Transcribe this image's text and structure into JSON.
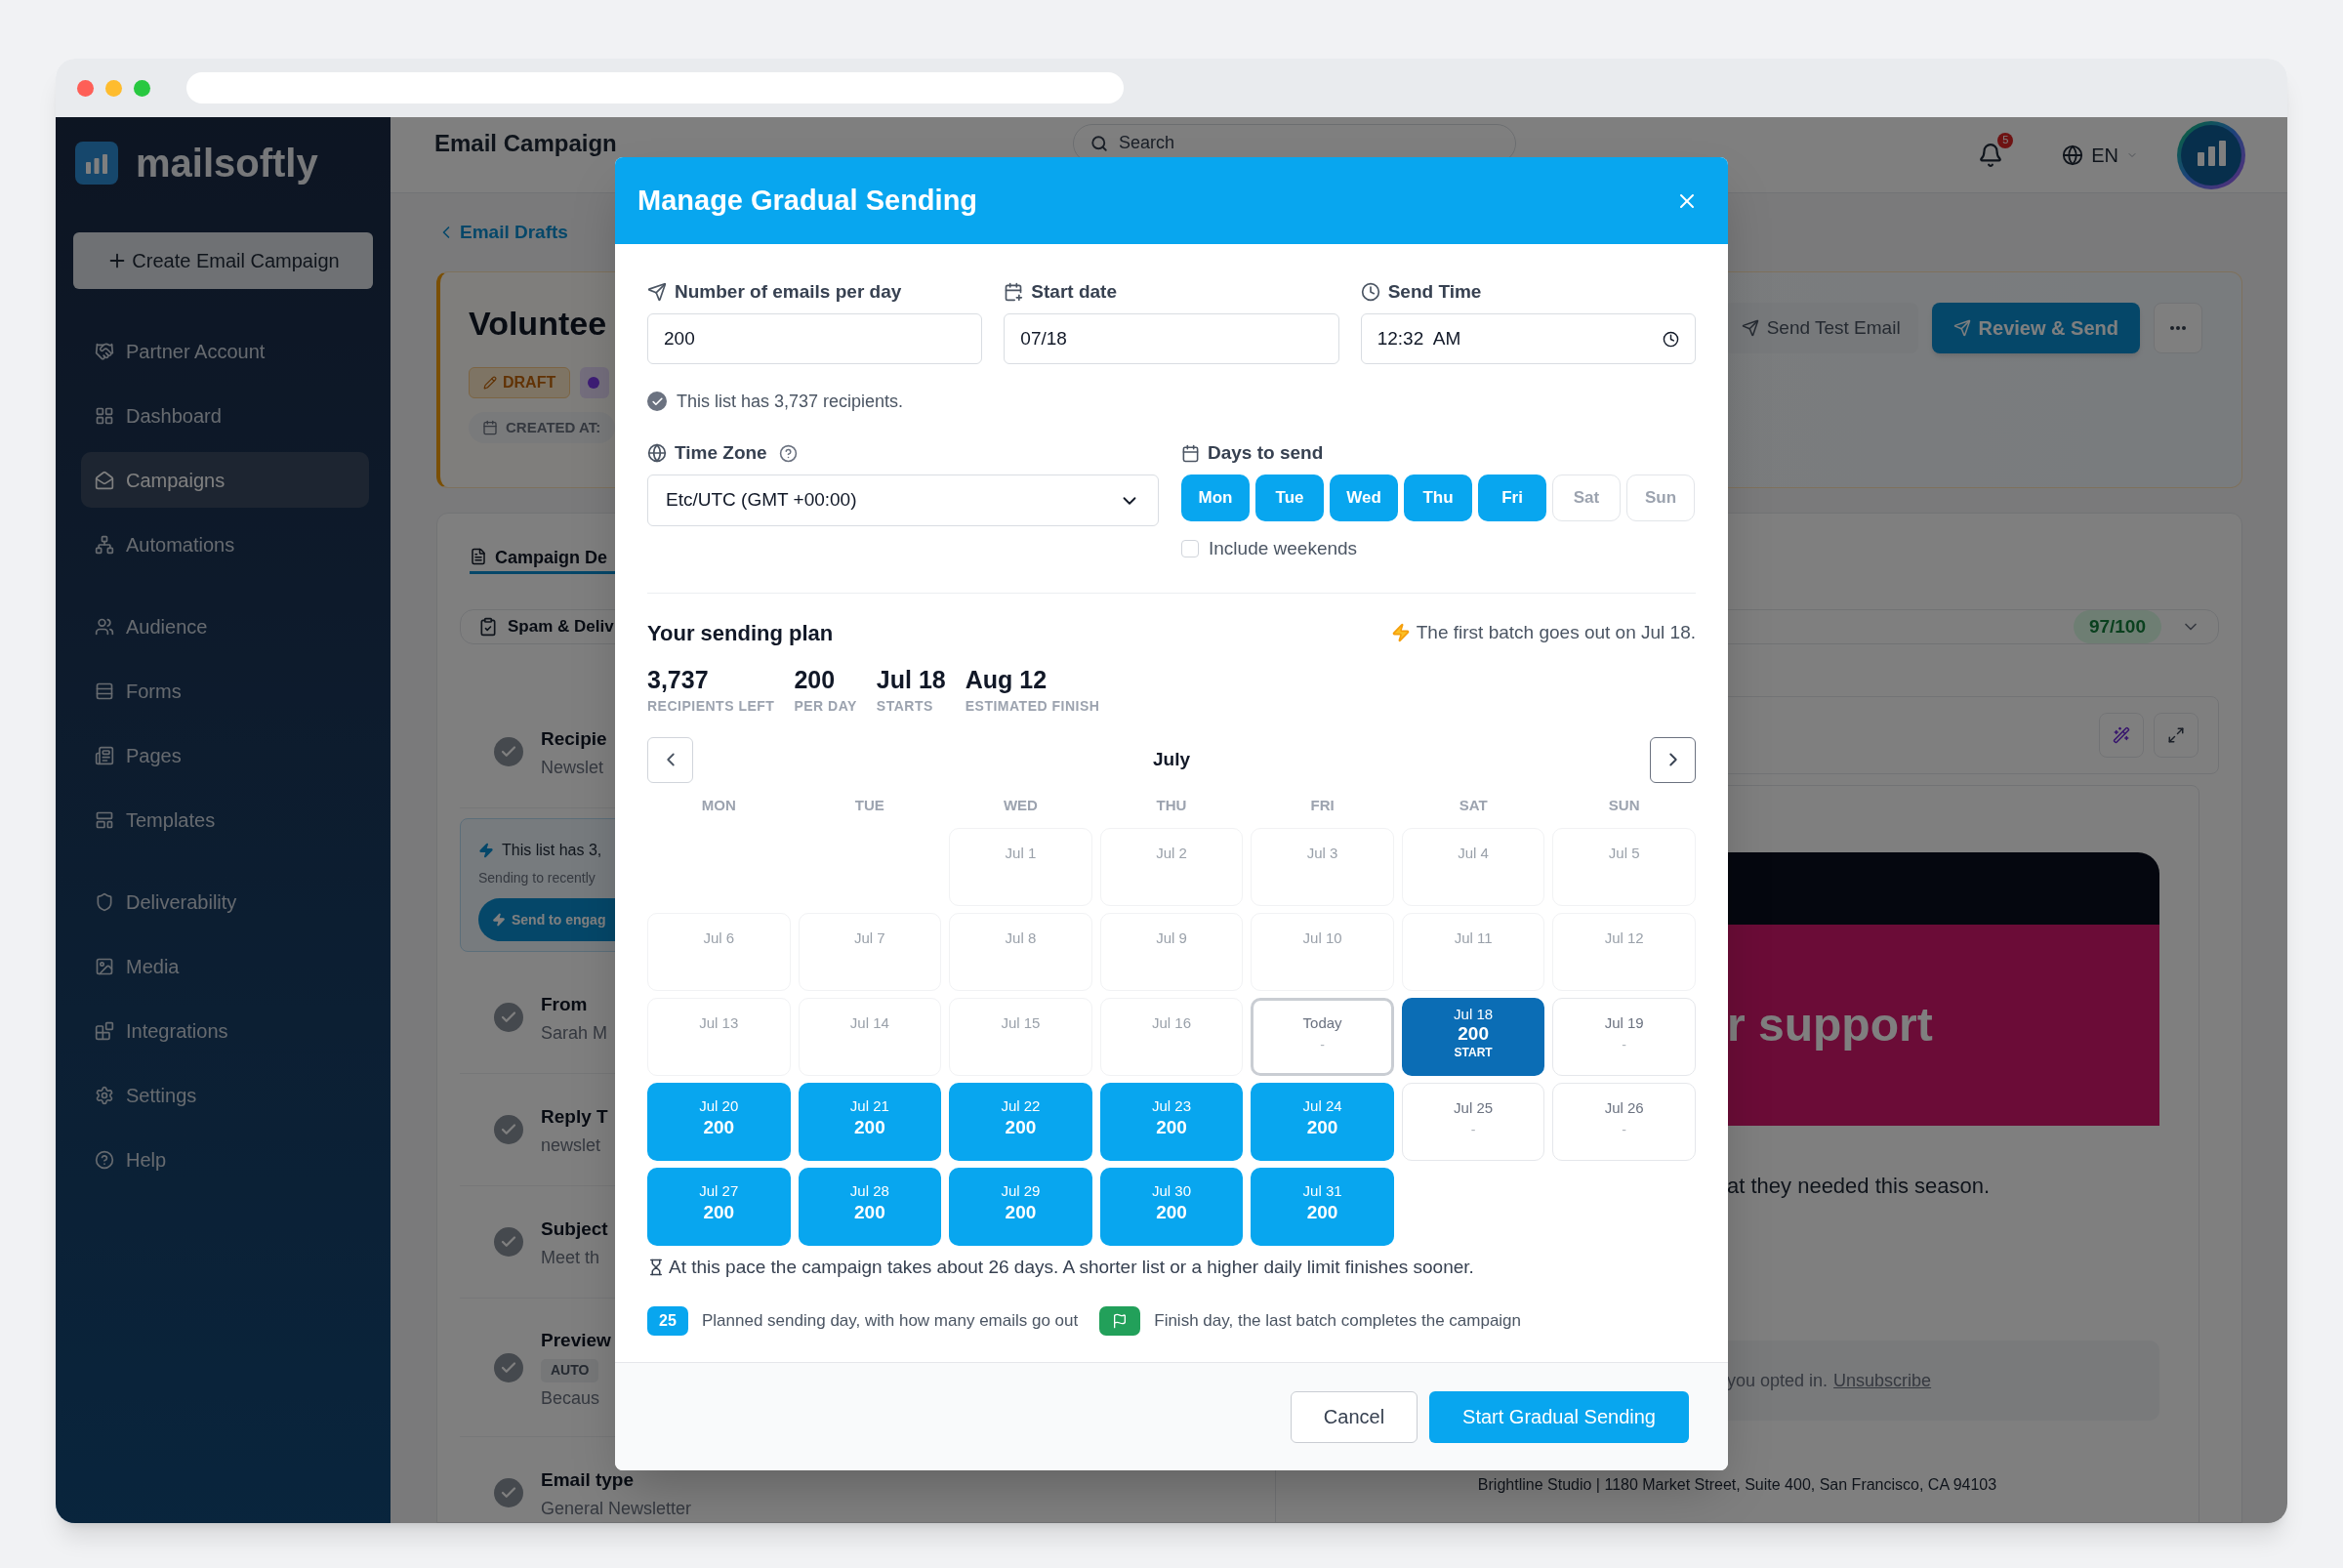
{
  "sidebar": {
    "logo": "mailsoftly",
    "create_button": "Create Email Campaign",
    "groups": [
      [
        {
          "label": "Partner Account",
          "selected": false
        },
        {
          "label": "Dashboard",
          "selected": false
        },
        {
          "label": "Campaigns",
          "selected": true
        },
        {
          "label": "Automations",
          "selected": false
        }
      ],
      [
        {
          "label": "Audience",
          "selected": false
        },
        {
          "label": "Forms",
          "selected": false
        },
        {
          "label": "Pages",
          "selected": false
        },
        {
          "label": "Templates",
          "selected": false
        }
      ],
      [
        {
          "label": "Deliverability",
          "selected": false
        },
        {
          "label": "Media",
          "selected": false
        },
        {
          "label": "Integrations",
          "selected": false
        },
        {
          "label": "Settings",
          "selected": false
        },
        {
          "label": "Help",
          "selected": false
        }
      ]
    ]
  },
  "header": {
    "title": "Email Campaign",
    "search": {
      "placeholder": "Search"
    },
    "notifications": "5",
    "language": "EN"
  },
  "campaign": {
    "back_link": "Email Drafts",
    "title": "Voluntee",
    "status": "DRAFT",
    "created_label": "CREATED AT:",
    "test_button": "Send Test Email",
    "review_button": "Review & Send"
  },
  "details": {
    "tab": "Campaign De",
    "spam": {
      "label": "Spam & Deliv",
      "score": "97/100"
    },
    "checklist": [
      {
        "kind": "field",
        "title": "Recipie",
        "value": "Newslet"
      },
      {
        "kind": "notice",
        "title": "This list has 3,",
        "value": "Sending to recently",
        "button": "Send to engag"
      },
      {
        "kind": "field",
        "title": "From",
        "value": "Sarah M"
      },
      {
        "kind": "field",
        "title": "Reply T",
        "value": "newslet"
      },
      {
        "kind": "field",
        "title": "Subject",
        "value": "Meet th"
      },
      {
        "kind": "field",
        "title": "Preview",
        "badge": "AUTO",
        "value": "Becaus"
      },
      {
        "kind": "field",
        "title": "Email type",
        "value": "General Newsletter"
      }
    ]
  },
  "preview": {
    "headline": "r support",
    "body": "at they needed this season.",
    "footer_text": "you opted in.",
    "unsubscribe": "Unsubscribe",
    "address": "Brightline Studio | 1180 Market Street, Suite 400, San Francisco, CA 94103"
  },
  "modal": {
    "title": "Manage Gradual Sending",
    "fields": [
      {
        "label": "Number of emails per day",
        "value": "200"
      },
      {
        "label": "Start date",
        "value": "07/18"
      },
      {
        "label": "Send Time",
        "value": "12:32  AM"
      }
    ],
    "recipients_note": "This list has 3,737 recipients.",
    "time_zone": {
      "label": "Time Zone",
      "value": "Etc/UTC (GMT +00:00)"
    },
    "days_to_send": {
      "label": "Days to send",
      "items": [
        {
          "label": "Mon",
          "selected": true
        },
        {
          "label": "Tue",
          "selected": true
        },
        {
          "label": "Wed",
          "selected": true
        },
        {
          "label": "Thu",
          "selected": true
        },
        {
          "label": "Fri",
          "selected": true
        },
        {
          "label": "Sat",
          "selected": false
        },
        {
          "label": "Sun",
          "selected": false
        }
      ],
      "include_weekends": {
        "label": "Include weekends",
        "checked": false
      }
    },
    "plan": {
      "title": "Your sending plan",
      "first_batch": "The first batch goes out on Jul 18.",
      "stats": [
        {
          "value": "3,737",
          "label": "RECIPIENTS LEFT"
        },
        {
          "value": "200",
          "label": "PER DAY"
        },
        {
          "value": "Jul 18",
          "label": "STARTS"
        },
        {
          "value": "Aug 12",
          "label": "ESTIMATED FINISH"
        }
      ]
    },
    "calendar": {
      "month": "July",
      "weekdays": [
        "MON",
        "TUE",
        "WED",
        "THU",
        "FRI",
        "SAT",
        "SUN"
      ],
      "weeks": [
        [
          {
            "label": "Jul 1",
            "kind": "past"
          },
          {
            "label": "Jul 2",
            "kind": "past"
          },
          {
            "label": "Jul 3",
            "kind": "past"
          },
          {
            "label": "Jul 4",
            "kind": "past"
          },
          {
            "label": "Jul 5",
            "kind": "past"
          }
        ],
        [
          {
            "label": "Jul 6",
            "kind": "past"
          },
          {
            "label": "Jul 7",
            "kind": "past"
          },
          {
            "label": "Jul 8",
            "kind": "past"
          },
          {
            "label": "Jul 9",
            "kind": "past"
          },
          {
            "label": "Jul 10",
            "kind": "past"
          },
          {
            "label": "Jul 11",
            "kind": "past"
          },
          {
            "label": "Jul 12",
            "kind": "past"
          }
        ],
        [
          {
            "label": "Jul 13",
            "kind": "past"
          },
          {
            "label": "Jul 14",
            "kind": "past"
          },
          {
            "label": "Jul 15",
            "kind": "past"
          },
          {
            "label": "Jul 16",
            "kind": "past"
          },
          {
            "label": "Today",
            "count": "-",
            "kind": "today"
          },
          {
            "label": "Jul 18",
            "count": "200",
            "note": "START",
            "kind": "start"
          },
          {
            "label": "Jul 19",
            "count": "-",
            "kind": "off"
          }
        ],
        [
          {
            "label": "Jul 20",
            "count": "200",
            "kind": "planned"
          },
          {
            "label": "Jul 21",
            "count": "200",
            "kind": "planned"
          },
          {
            "label": "Jul 22",
            "count": "200",
            "kind": "planned"
          },
          {
            "label": "Jul 23",
            "count": "200",
            "kind": "planned"
          },
          {
            "label": "Jul 24",
            "count": "200",
            "kind": "planned"
          },
          {
            "label": "Jul 25",
            "count": "-",
            "kind": "off"
          },
          {
            "label": "Jul 26",
            "count": "-",
            "kind": "off"
          }
        ],
        [
          {
            "label": "Jul 27",
            "count": "200",
            "kind": "planned"
          },
          {
            "label": "Jul 28",
            "count": "200",
            "kind": "planned"
          },
          {
            "label": "Jul 29",
            "count": "200",
            "kind": "planned"
          },
          {
            "label": "Jul 30",
            "count": "200",
            "kind": "planned"
          },
          {
            "label": "Jul 31",
            "count": "200",
            "kind": "planned"
          }
        ]
      ]
    },
    "pace_note": "At this pace the campaign takes about 26 days. A shorter list or a higher daily limit finishes sooner.",
    "legend": [
      {
        "kind": "planned",
        "badge": "25",
        "text": "Planned sending day, with how many emails go out"
      },
      {
        "kind": "finish",
        "text": "Finish day, the last batch completes the campaign"
      }
    ],
    "cancel_button": "Cancel",
    "start_button": "Start Gradual Sending"
  }
}
